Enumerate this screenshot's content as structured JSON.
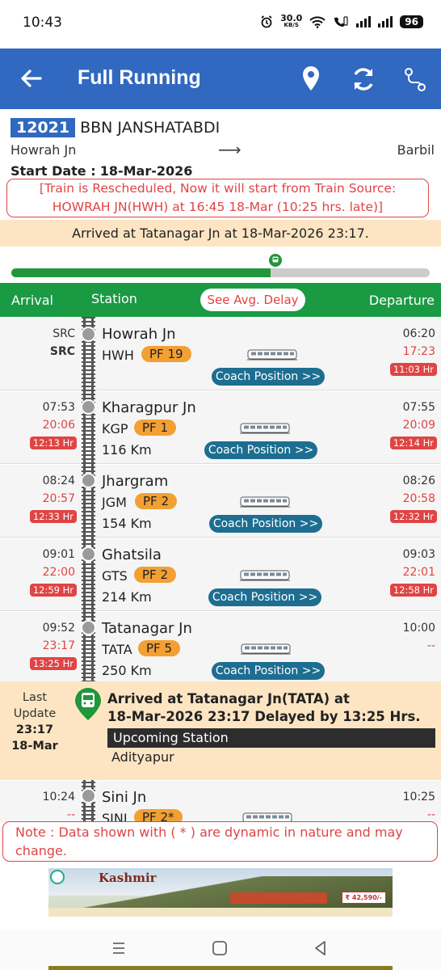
{
  "status_bar": {
    "time": "10:43",
    "net_speed": "30.0",
    "net_unit": "KB/S",
    "battery": "96"
  },
  "app_bar": {
    "title": "Full Running",
    "icons": [
      "back-arrow-icon",
      "location-pin-icon",
      "refresh-icon",
      "route-icon"
    ]
  },
  "train": {
    "number": "12021",
    "name": "BBN JANSHATABDI",
    "from": "Howrah Jn",
    "to": "Barbil",
    "start_date_label": "Start Date :",
    "start_date": "18-Mar-2026",
    "reschedule_line1": "[Train is Rescheduled, Now it will start from Train Source:",
    "reschedule_line2": "HOWRAH JN(HWH) at 16:45 18-Mar (10:25 hrs. late)]",
    "arrived_banner": "Arrived at Tatanagar Jn at 18-Mar-2026 23:17.",
    "progress_fraction": 0.62
  },
  "table_header": {
    "arrival": "Arrival",
    "station": "Station",
    "avg_delay": "See Avg. Delay",
    "departure": "Departure"
  },
  "coach_button": "Coach Position >>",
  "stations": [
    {
      "name": "Howrah Jn",
      "code": "HWH",
      "pf": "PF 19",
      "km": "",
      "sch_arr": "SRC",
      "act_arr": "SRC",
      "delay_arr": "",
      "sch_dep": "06:20",
      "act_dep": "17:23",
      "delay_dep": "11:03 Hr"
    },
    {
      "name": "Kharagpur Jn",
      "code": "KGP",
      "pf": "PF 1",
      "km": "116 Km",
      "sch_arr": "07:53",
      "act_arr": "20:06",
      "delay_arr": "12:13 Hr",
      "sch_dep": "07:55",
      "act_dep": "20:09",
      "delay_dep": "12:14 Hr"
    },
    {
      "name": "Jhargram",
      "code": "JGM",
      "pf": "PF 2",
      "km": "154 Km",
      "sch_arr": "08:24",
      "act_arr": "20:57",
      "delay_arr": "12:33 Hr",
      "sch_dep": "08:26",
      "act_dep": "20:58",
      "delay_dep": "12:32 Hr"
    },
    {
      "name": "Ghatsila",
      "code": "GTS",
      "pf": "PF 2",
      "km": "214 Km",
      "sch_arr": "09:01",
      "act_arr": "22:00",
      "delay_arr": "12:59 Hr",
      "sch_dep": "09:03",
      "act_dep": "22:01",
      "delay_dep": "12:58 Hr"
    },
    {
      "name": "Tatanagar Jn",
      "code": "TATA",
      "pf": "PF 5",
      "km": "250 Km",
      "sch_arr": "09:52",
      "act_arr": "23:17",
      "delay_arr": "13:25 Hr",
      "sch_dep": "10:00",
      "act_dep": "--",
      "delay_dep": ""
    },
    {
      "name": "Sini Jn",
      "code": "SINI",
      "pf": "PF 2*",
      "km": "",
      "sch_arr": "10:24",
      "act_arr": "--",
      "delay_arr": "",
      "sch_dep": "10:25",
      "act_dep": "--",
      "delay_dep": ""
    }
  ],
  "current": {
    "last_update_label1": "Last",
    "last_update_label2": "Update",
    "last_update_time": "23:17",
    "last_update_date": "18-Mar",
    "message_line1": "Arrived at Tatanagar Jn(TATA) at",
    "message_line2": "18-Mar-2026 23:17 Delayed by 13:25 Hrs.",
    "upcoming_label": "Upcoming Station",
    "next_station": "Adityapur"
  },
  "note": {
    "line1": "Note : Data shown with ( * ) are dynamic in nature and may",
    "line2": "change."
  },
  "ad": {
    "brand": "Kashmir",
    "price": "₹ 42,590/-"
  },
  "colors": {
    "primary": "#3168c0",
    "green": "#1b9a44",
    "red": "#e04444",
    "orange": "#f2a033",
    "banner": "#fde5c3",
    "coach_button": "#1d6e91"
  }
}
